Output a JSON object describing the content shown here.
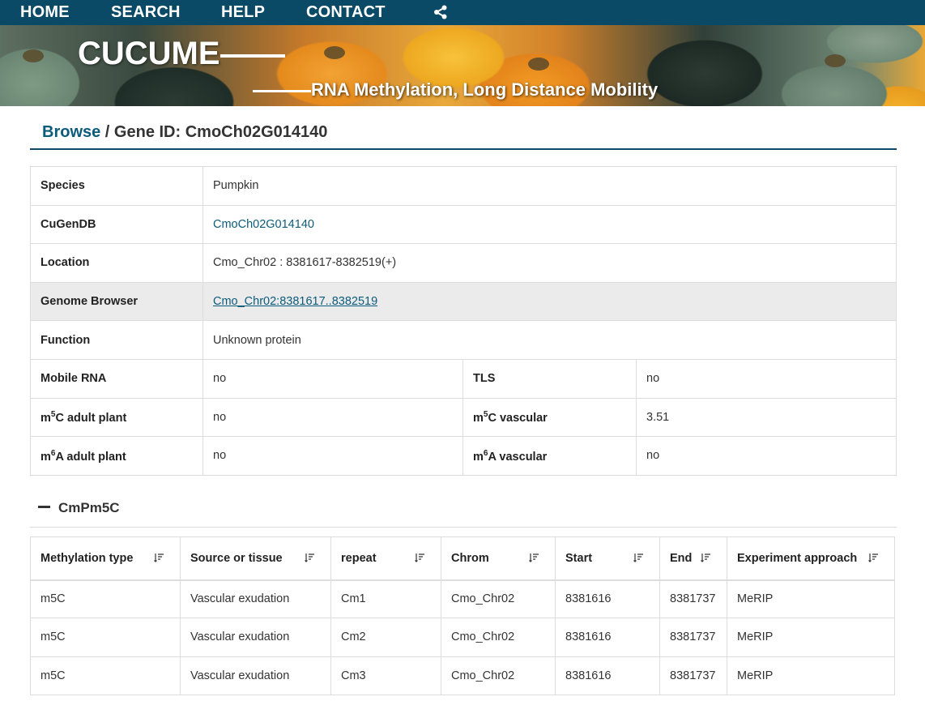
{
  "nav": {
    "home": "HOME",
    "search": "SEARCH",
    "help": "HELP",
    "contact": "CONTACT",
    "share_icon": "share-icon"
  },
  "banner": {
    "brand": "CUCUME",
    "tagline": "RNA Methylation, Long Distance Mobility"
  },
  "breadcrumb": {
    "link": "Browse",
    "separator": " / ",
    "current": "Gene ID: CmoCh02G014140"
  },
  "info": {
    "species": {
      "label": "Species",
      "value": "Pumpkin"
    },
    "cugendb": {
      "label": "CuGenDB",
      "value": "CmoCh02G014140"
    },
    "location": {
      "label": "Location",
      "value": "Cmo_Chr02 : 8381617-8382519(+)"
    },
    "genome_browser": {
      "label": "Genome Browser",
      "value": "Cmo_Chr02:8381617..8382519"
    },
    "function": {
      "label": "Function",
      "value": "Unknown protein"
    },
    "mobile_rna": {
      "label": "Mobile RNA",
      "value": "no"
    },
    "tls": {
      "label": "TLS",
      "value": "no"
    },
    "m5c_adult": {
      "label_pre": "m",
      "label_sup": "5",
      "label_post": "C adult plant",
      "value": "no"
    },
    "m5c_vascular": {
      "label_pre": "m",
      "label_sup": "5",
      "label_post": "C vascular",
      "value": "3.51"
    },
    "m6a_adult": {
      "label_pre": "m",
      "label_sup": "6",
      "label_post": "A adult plant",
      "value": "no"
    },
    "m6a_vascular": {
      "label_pre": "m",
      "label_sup": "6",
      "label_post": "A vascular",
      "value": "no"
    }
  },
  "section": {
    "title": "CmPm5C",
    "columns": [
      "Methylation type",
      "Source or tissue",
      "repeat",
      "Chrom",
      "Start",
      "End",
      "Experiment approach"
    ],
    "rows": [
      [
        "m5C",
        "Vascular exudation",
        "Cm1",
        "Cmo_Chr02",
        "8381616",
        "8381737",
        "MeRIP"
      ],
      [
        "m5C",
        "Vascular exudation",
        "Cm2",
        "Cmo_Chr02",
        "8381616",
        "8381737",
        "MeRIP"
      ],
      [
        "m5C",
        "Vascular exudation",
        "Cm3",
        "Cmo_Chr02",
        "8381616",
        "8381737",
        "MeRIP"
      ]
    ]
  },
  "colors": {
    "nav_bg": "#0b4a66",
    "link": "#0b5b7a",
    "shaded_row": "#ebebeb",
    "border": "#dddddd"
  }
}
